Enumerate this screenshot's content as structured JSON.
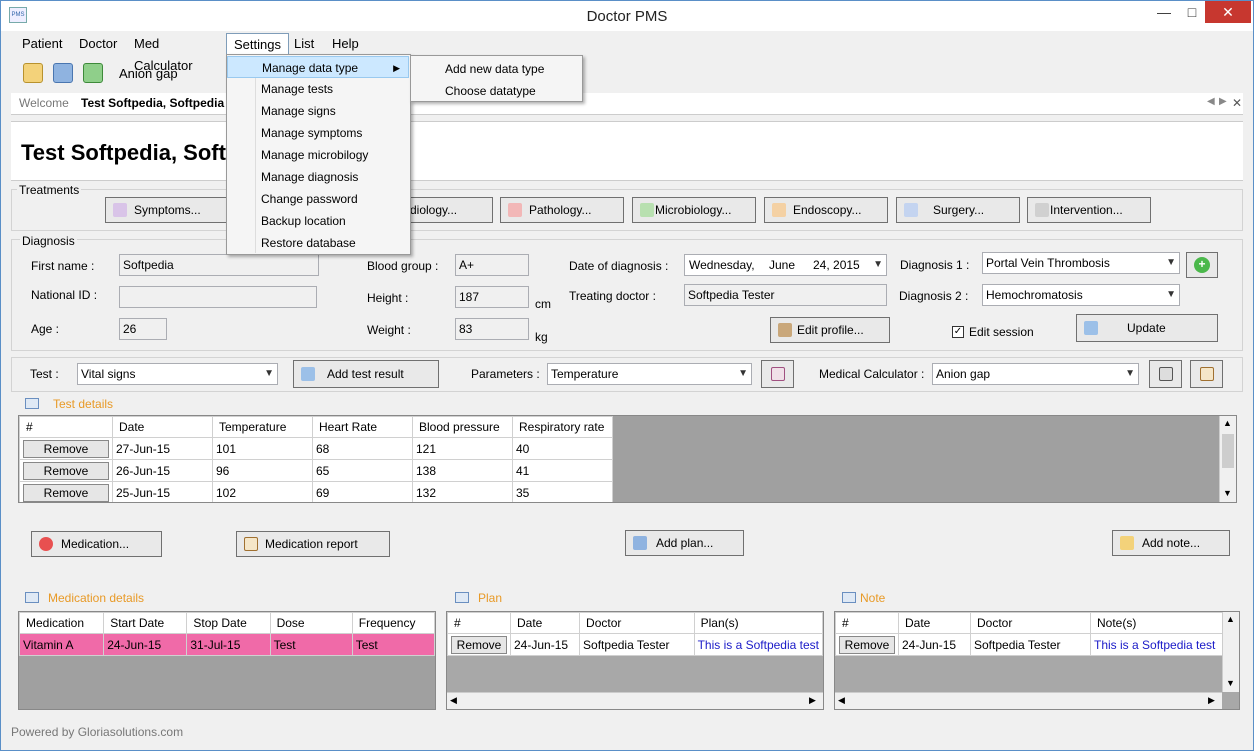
{
  "app": {
    "title": "Doctor PMS",
    "icon_text": "PMS"
  },
  "menu": {
    "items": [
      "Patient",
      "Doctor",
      "Med Calculator",
      "Settings",
      "List",
      "Help"
    ]
  },
  "toolbar": {
    "text": "Anion gap"
  },
  "settings_menu": {
    "items": [
      "Manage data type",
      "Manage tests",
      "Manage signs",
      "Manage symptoms",
      "Manage microbilogy",
      "Manage diagnosis",
      "Change password",
      "Backup location",
      "Restore database"
    ],
    "submenu": [
      "Add new data type",
      "Choose datatype"
    ]
  },
  "tabs": {
    "welcome": "Welcome",
    "active": "Test Softpedia, Softpedia"
  },
  "patient": {
    "header_name": "Test Softpedia, Soft"
  },
  "treatments": {
    "label": "Treatments",
    "buttons": [
      "Symptoms...",
      "diology...",
      "Pathology...",
      "Microbiology...",
      "Endoscopy...",
      "Surgery...",
      "Intervention..."
    ]
  },
  "diagnosis": {
    "label": "Diagnosis",
    "first_name_label": "First name :",
    "first_name": "Softpedia",
    "national_id_label": "National ID :",
    "national_id": "",
    "age_label": "Age :",
    "age": "26",
    "blood_group_label": "Blood group :",
    "blood_group": "A+",
    "height_label": "Height :",
    "height": "187",
    "height_unit": "cm",
    "weight_label": "Weight :",
    "weight": "83",
    "weight_unit": "kg",
    "date_label": "Date of diagnosis :",
    "date_day": "Wednesday,",
    "date_month": "June",
    "date_rest": "24, 2015",
    "doctor_label": "Treating doctor :",
    "doctor": "Softpedia Tester",
    "diag1_label": "Diagnosis 1 :",
    "diag1": "Portal Vein Thrombosis",
    "diag2_label": "Diagnosis 2 :",
    "diag2": "Hemochromatosis",
    "edit_profile": "Edit profile...",
    "edit_session": "Edit session",
    "update": "Update"
  },
  "test_bar": {
    "test_label": "Test :",
    "test_value": "Vital signs",
    "add_result": "Add test result",
    "params_label": "Parameters :",
    "params_value": "Temperature",
    "calc_label": "Medical Calculator :",
    "calc_value": "Anion gap"
  },
  "test_details": {
    "title": "Test details",
    "columns": [
      "#",
      "Date",
      "Temperature",
      "Heart Rate",
      "Blood pressure",
      "Respiratory rate"
    ],
    "rows": [
      {
        "btn": "Remove",
        "date": "27-Jun-15",
        "temp": "101",
        "hr": "68",
        "bp": "121",
        "rr": "40"
      },
      {
        "btn": "Remove",
        "date": "26-Jun-15",
        "temp": "96",
        "hr": "65",
        "bp": "138",
        "rr": "41"
      },
      {
        "btn": "Remove",
        "date": "25-Jun-15",
        "temp": "102",
        "hr": "69",
        "bp": "132",
        "rr": "35"
      }
    ]
  },
  "actions": {
    "medication": "Medication...",
    "med_report": "Medication report",
    "add_plan": "Add plan...",
    "add_note": "Add note..."
  },
  "medication_details": {
    "title": "Medication details",
    "columns": [
      "Medication",
      "Start Date",
      "Stop Date",
      "Dose",
      "Frequency"
    ],
    "row": [
      "Vitamin A",
      "24-Jun-15",
      "31-Jul-15",
      "Test",
      "Test"
    ],
    "row_color": "#f06aa8"
  },
  "plan": {
    "title": "Plan",
    "columns": [
      "#",
      "Date",
      "Doctor",
      "Plan(s)"
    ],
    "row": {
      "btn": "Remove",
      "date": "24-Jun-15",
      "doctor": "Softpedia Tester",
      "text": "This is a Softpedia test"
    }
  },
  "note": {
    "title": "Note",
    "columns": [
      "#",
      "Date",
      "Doctor",
      "Note(s)"
    ],
    "row": {
      "btn": "Remove",
      "date": "24-Jun-15",
      "doctor": "Softpedia Tester",
      "text": "This is a Softpedia test"
    }
  },
  "status": {
    "text": "Powered by Gloriasolutions.com"
  },
  "colors": {
    "accent": "#e89a27",
    "link": "#1a1ac8",
    "highlight": "#cce8ff"
  }
}
